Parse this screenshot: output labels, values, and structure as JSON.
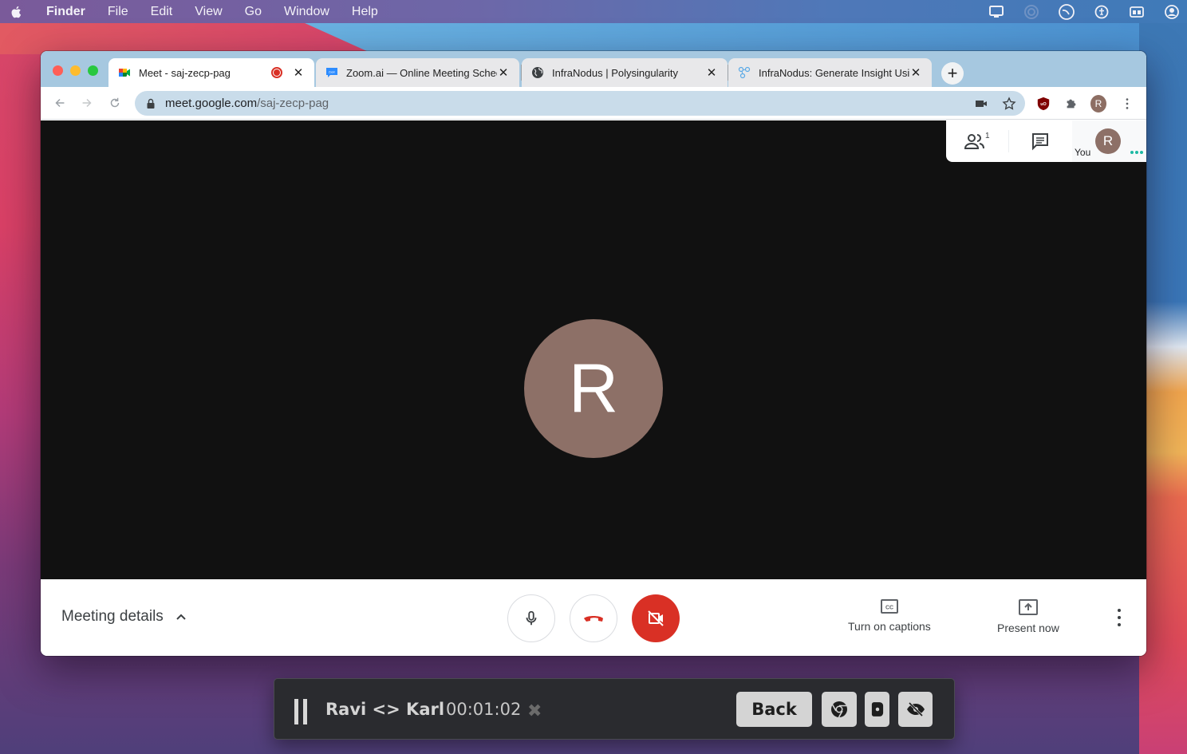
{
  "menubar": {
    "app": "Finder",
    "items": [
      "File",
      "Edit",
      "View",
      "Go",
      "Window",
      "Help"
    ],
    "status_icons": [
      "display-icon",
      "airdrop-icon",
      "time-machine-icon",
      "accessibility-icon",
      "window-icon",
      "user-icon"
    ]
  },
  "browser": {
    "tabs": [
      {
        "title": "Meet - saj-zecp-pag",
        "favicon": "google-meet-icon",
        "recording": true,
        "active": true
      },
      {
        "title": "Zoom.ai — Online Meeting Scheduling",
        "favicon": "zoom-ai-icon",
        "active": false
      },
      {
        "title": "InfraNodus | Polysingularity",
        "favicon": "globe-icon",
        "active": false
      },
      {
        "title": "InfraNodus: Generate Insight Using",
        "favicon": "infranodus-icon",
        "active": false
      }
    ],
    "new_tab_label": "+",
    "close_glyph": "✕",
    "url_host": "meet.google.com",
    "url_path": "/saj-zecp-pag",
    "profile_initial": "R"
  },
  "meet": {
    "participant_count": "1",
    "self_label": "You",
    "self_initial": "R",
    "main_initial": "R",
    "meeting_details_label": "Meeting details",
    "captions_label": "Turn on captions",
    "present_label": "Present now",
    "colors": {
      "end_call": "#d93025",
      "avatar": "#8d7067",
      "stage": "#111111"
    }
  },
  "recorder": {
    "title": "Ravi <> Karl",
    "elapsed": "00:01:02",
    "close_glyph": "✖",
    "back_label": "Back"
  }
}
